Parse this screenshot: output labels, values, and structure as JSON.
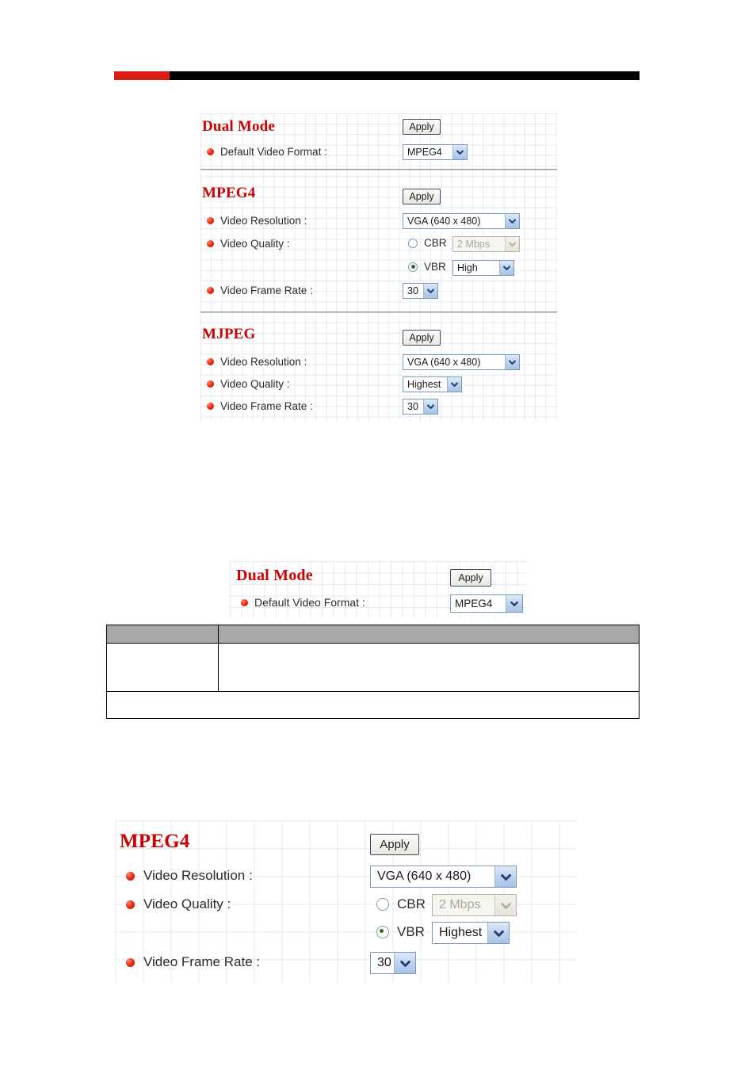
{
  "header": {
    "accent_color": "#d81f16",
    "bar_color": "#000000"
  },
  "panels": [
    {
      "id": "panel-top",
      "sections": [
        {
          "id": "dual-mode",
          "title": "Dual Mode",
          "apply_label": "Apply",
          "fields": [
            {
              "label": "Default Video Format :",
              "control": "select",
              "value": "MPEG4"
            }
          ]
        },
        {
          "id": "mpeg4",
          "title": "MPEG4",
          "apply_label": "Apply",
          "fields": [
            {
              "label": "Video Resolution :",
              "control": "select",
              "value": "VGA (640 x 480)"
            },
            {
              "label": "Video Quality :",
              "control": "radio-group",
              "options": [
                {
                  "radio_label": "CBR",
                  "checked": false,
                  "value": "2 Mbps",
                  "disabled": true
                },
                {
                  "radio_label": "VBR",
                  "checked": true,
                  "value": "High",
                  "disabled": false
                }
              ]
            },
            {
              "label": "Video Frame Rate :",
              "control": "select",
              "value": "30"
            }
          ]
        },
        {
          "id": "mjpeg",
          "title": "MJPEG",
          "apply_label": "Apply",
          "fields": [
            {
              "label": "Video Resolution :",
              "control": "select",
              "value": "VGA (640 x 480)"
            },
            {
              "label": "Video Quality :",
              "control": "select",
              "value": "Highest"
            },
            {
              "label": "Video Frame Rate :",
              "control": "select",
              "value": "30"
            }
          ]
        }
      ]
    },
    {
      "id": "panel-dualmode-detail",
      "sections": [
        {
          "id": "dual-mode-2",
          "title": "Dual Mode",
          "apply_label": "Apply",
          "fields": [
            {
              "label": "Default Video Format :",
              "control": "select",
              "value": "MPEG4"
            }
          ]
        }
      ]
    },
    {
      "id": "panel-mpeg4-detail",
      "sections": [
        {
          "id": "mpeg4-2",
          "title": "MPEG4",
          "apply_label": "Apply",
          "fields": [
            {
              "label": "Video Resolution :",
              "control": "select",
              "value": "VGA (640 x 480)"
            },
            {
              "label": "Video Quality :",
              "control": "radio-group",
              "options": [
                {
                  "radio_label": "CBR",
                  "checked": false,
                  "value": "2 Mbps",
                  "disabled": true
                },
                {
                  "radio_label": "VBR",
                  "checked": true,
                  "value": "Highest",
                  "disabled": false
                }
              ]
            },
            {
              "label": "Video Frame Rate :",
              "control": "select",
              "value": "30"
            }
          ]
        }
      ]
    }
  ],
  "description_table": {
    "header_cells": [
      "",
      ""
    ],
    "rows": [
      [
        "",
        ""
      ],
      [
        ""
      ]
    ]
  },
  "colors": {
    "title_red": "#cc0000",
    "bullet_red": "#ec2b10",
    "select_border": "#7a98b8",
    "select_arrow": "#bdd2ee",
    "table_header_gray": "#a8a8a8",
    "separator": "#9a9a86"
  }
}
